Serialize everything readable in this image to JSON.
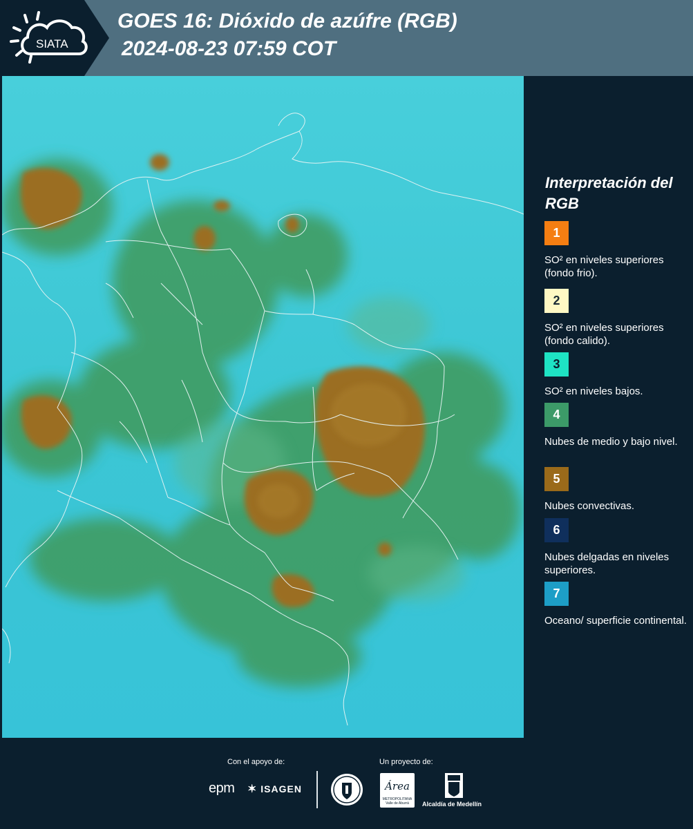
{
  "header": {
    "logo_text": "SIATA",
    "title_line1": "GOES 16: Dióxido de azúfre (RGB)",
    "title_line2": "2024-08-23 07:59 COT"
  },
  "legend": {
    "title": "Interpretación del RGB",
    "items": [
      {
        "number": "1",
        "color": "#f57e12",
        "text_color": "#ffffff",
        "label": "SO² en niveles superiores (fondo frio)."
      },
      {
        "number": "2",
        "color": "#fff8c4",
        "text_color": "#1a2a35",
        "label": "SO² en niveles superiores (fondo calido)."
      },
      {
        "number": "3",
        "color": "#1ee3c4",
        "text_color": "#0b1f2e",
        "label": "SO² en niveles bajos."
      },
      {
        "number": "4",
        "color": "#3c9a68",
        "text_color": "#ffffff",
        "label": "Nubes de medio y bajo nivel."
      },
      {
        "number": "5",
        "color": "#9a6a1a",
        "text_color": "#ffffff",
        "label": "Nubes convectivas."
      },
      {
        "number": "6",
        "color": "#0f2f5c",
        "text_color": "#ffffff",
        "label": "Nubes delgadas en niveles superiores."
      },
      {
        "number": "7",
        "color": "#1d9ec7",
        "text_color": "#ffffff",
        "label": "Oceano/ superficie continental."
      }
    ]
  },
  "footer": {
    "support_label": "Con el apoyo de:",
    "project_label": "Un proyecto de:",
    "sponsors": [
      "epm",
      "ISAGEN"
    ],
    "partners": [
      "Área Metropolitana Valle de Aburrá",
      "Alcaldía de Medellín"
    ],
    "area_logo": "Área",
    "area_subtitle": "METROPOLITANA Valle de Aburrá",
    "alcaldia_label": "Alcaldía de Medellín"
  },
  "map": {
    "region": "Colombia",
    "background_color": "#3ec9d6",
    "cloud_medium_color": "#3f9a5c",
    "convective_color": "#9b6e22",
    "border_color": "#e8f4f4"
  }
}
